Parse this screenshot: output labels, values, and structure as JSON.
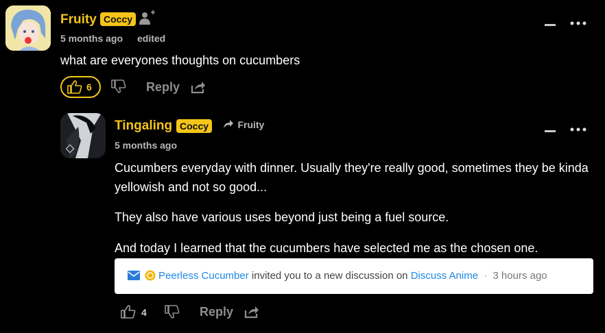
{
  "comment1": {
    "username": "Fruity",
    "badge": "Coccy",
    "time": "5 months ago",
    "edited": "edited",
    "body": "what are everyones thoughts on cucumbers",
    "likes": "6",
    "reply_label": "Reply"
  },
  "reply1": {
    "username": "Tingaling",
    "badge": "Coccy",
    "reply_to": "Fruity",
    "time": "5 months ago",
    "paragraphs": [
      "Cucumbers everyday with dinner. Usually they're really good, sometimes they be kinda yellowish and not so good...",
      "They also have various uses beyond just being a fuel source.",
      "And today I learned that the cucumbers have selected me as the chosen one."
    ],
    "embed": {
      "user": "Peerless Cucumber",
      "text": "invited you to a new discussion on",
      "forum": "Discuss Anime",
      "sep": "·",
      "time": "3 hours ago"
    },
    "likes": "4",
    "reply_label": "Reply"
  },
  "colors": {
    "accent": "#f5c518",
    "background": "#000000",
    "link": "#1e88e5"
  }
}
